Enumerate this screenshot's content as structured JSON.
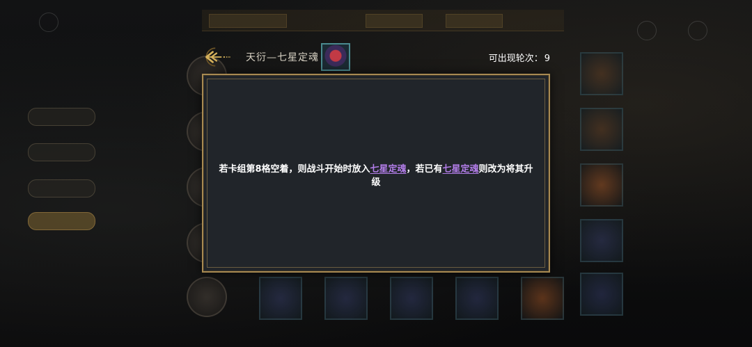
{
  "header": {
    "title": "天衍—七星定魂",
    "appear_label": "可出现轮次：",
    "appear_count": "9",
    "back_icon": "ornate-back-arrow-icon",
    "card_icon": "seven-star-soul-card-icon"
  },
  "description": {
    "part1": "若卡组第8格空着，则战斗开始时放入",
    "keyword1": "七星定魂",
    "part2": "，若已有",
    "keyword2": "七星定魂",
    "part3": "则改为将其升级"
  },
  "colors": {
    "panel_bg": "#21252a",
    "panel_border": "#a88a52",
    "keyword": "#b27de8",
    "header_gold": "#c9a04c"
  }
}
